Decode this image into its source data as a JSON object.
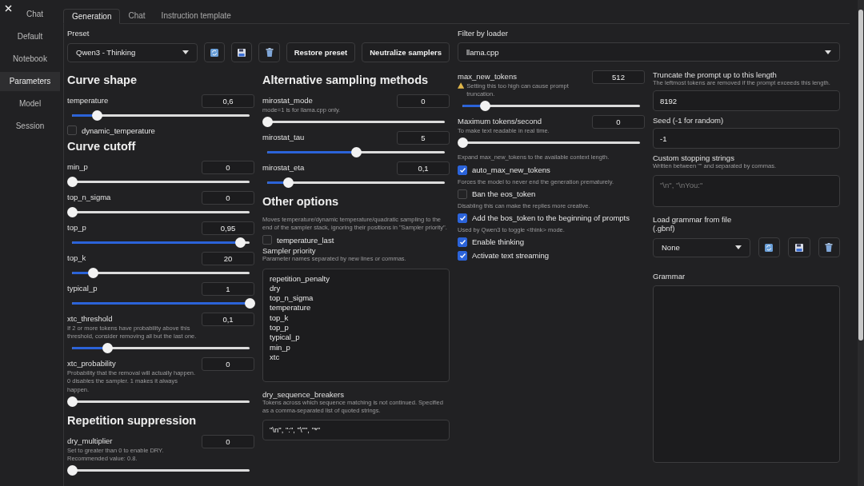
{
  "sidebar": {
    "items": [
      {
        "label": "Chat",
        "selected": false
      },
      {
        "label": "Default",
        "selected": false
      },
      {
        "label": "Notebook",
        "selected": false
      },
      {
        "label": "Parameters",
        "selected": true
      },
      {
        "label": "Model",
        "selected": false
      },
      {
        "label": "Session",
        "selected": false
      }
    ]
  },
  "tabs": [
    {
      "label": "Generation",
      "selected": true
    },
    {
      "label": "Chat",
      "selected": false
    },
    {
      "label": "Instruction template",
      "selected": false
    }
  ],
  "preset": {
    "label": "Preset",
    "value": "Qwen3 - Thinking",
    "icon_buttons": [
      {
        "kind": "refresh"
      },
      {
        "kind": "save"
      },
      {
        "kind": "delete"
      }
    ],
    "buttons": [
      "Restore preset",
      "Neutralize samplers"
    ]
  },
  "loader_filter": {
    "label": "Filter by loader",
    "value": "llama.cpp"
  },
  "columns": [
    [
      {
        "kind": "heading",
        "text": "Curve shape"
      },
      {
        "kind": "slider",
        "label": "temperature",
        "value": "0,6",
        "level": 0.14
      },
      {
        "kind": "checkbox",
        "label": "dynamic_temperature",
        "checked": false
      },
      {
        "kind": "heading",
        "text": "Curve cutoff"
      },
      {
        "kind": "slider",
        "label": "min_p",
        "value": "0",
        "level": 0
      },
      {
        "kind": "slider",
        "label": "top_n_sigma",
        "value": "0",
        "level": 0
      },
      {
        "kind": "slider",
        "label": "top_p",
        "value": "0,95",
        "level": 0.95
      },
      {
        "kind": "slider",
        "label": "top_k",
        "value": "20",
        "level": 0.12
      },
      {
        "kind": "slider",
        "label": "typical_p",
        "value": "1",
        "level": 1
      },
      {
        "kind": "slider",
        "label": "xtc_threshold",
        "info": "If 2 or more tokens have probability above this threshold, consider removing all but the last one.",
        "value": "0,1",
        "level": 0.2
      },
      {
        "kind": "slider",
        "label": "xtc_probability",
        "info": "Probability that the removal will actually happen. 0 disables the sampler. 1 makes it always happen.",
        "value": "0",
        "level": 0
      },
      {
        "kind": "heading",
        "text": "Repetition suppression"
      },
      {
        "kind": "slider",
        "label": "dry_multiplier",
        "info": "Set to greater than 0 to enable DRY. Recommended value: 0.8.",
        "value": "0",
        "level": 0
      }
    ],
    [
      {
        "kind": "heading",
        "text": "Alternative sampling methods"
      },
      {
        "kind": "slider",
        "label": "mirostat_mode",
        "info": "mode=1 is for llama.cpp only.",
        "value": "0",
        "level": 0
      },
      {
        "kind": "slider",
        "label": "mirostat_tau",
        "value": "5",
        "level": 0.5
      },
      {
        "kind": "slider",
        "label": "mirostat_eta",
        "value": "0,1",
        "level": 0.12
      },
      {
        "kind": "heading",
        "text": "Other options"
      },
      {
        "kind": "checkbox",
        "info": "Moves temperature/dynamic temperature/quadratic sampling to the end of the sampler stack, ignoring their positions in \"Sampler priority\".",
        "label": "temperature_last",
        "checked": false
      },
      {
        "kind": "textarea",
        "label": "Sampler priority",
        "info": "Parameter names separated by new lines or commas.",
        "value": "repetition_penalty\ndry\ntop_n_sigma\ntemperature\ntop_k\ntop_p\ntypical_p\nmin_p\nxtc"
      },
      {
        "kind": "textarea",
        "label": "dry_sequence_breakers",
        "info": "Tokens across which sequence matching is not continued. Specified as a comma-separated list of quoted strings.",
        "value": "\"\\n\", \":\", \"\\\"\", \"*\""
      }
    ],
    [
      {
        "kind": "slider",
        "label": "max_new_tokens",
        "warning": "Setting this too high can cause prompt truncation.",
        "value": "512",
        "level": 0.13
      },
      {
        "kind": "slider",
        "label": "Maximum tokens/second",
        "info": "To make text readable in real time.",
        "value": "0",
        "level": 0
      },
      {
        "kind": "checkbox",
        "info": "Expand max_new_tokens to the available context length.",
        "label": "auto_max_new_tokens",
        "checked": true
      },
      {
        "kind": "checkbox",
        "info": "Forces the model to never end the generation prematurely.",
        "label": "Ban the eos_token",
        "checked": false
      },
      {
        "kind": "checkbox",
        "info": "Disabling this can make the replies more creative.",
        "label": "Add the bos_token to the beginning of prompts",
        "checked": true
      },
      {
        "kind": "checkbox",
        "info": "Used by Qwen3 to toggle <think> mode.",
        "label": "Enable thinking",
        "checked": true
      },
      {
        "kind": "checkbox",
        "label": "Activate text streaming",
        "checked": true
      }
    ],
    [
      {
        "kind": "field",
        "label": "Truncate the prompt up to this length",
        "info": "The leftmost tokens are removed if the prompt exceeds this length.",
        "value": "8192"
      },
      {
        "kind": "field",
        "label": "Seed (-1 for random)",
        "value": "-1"
      },
      {
        "kind": "textarea",
        "label": "Custom stopping strings",
        "info": "Written between \"\" and separated by commas.",
        "placeholder": "\"\\n\", \"\\nYou:\""
      },
      {
        "kind": "dropdown",
        "label": "Load grammar from file (.gbnf)",
        "value": "None",
        "icon_buttons": [
          {
            "kind": "refresh"
          },
          {
            "kind": "save"
          },
          {
            "kind": "delete"
          }
        ]
      },
      {
        "kind": "textarea",
        "label": "Grammar"
      }
    ]
  ]
}
